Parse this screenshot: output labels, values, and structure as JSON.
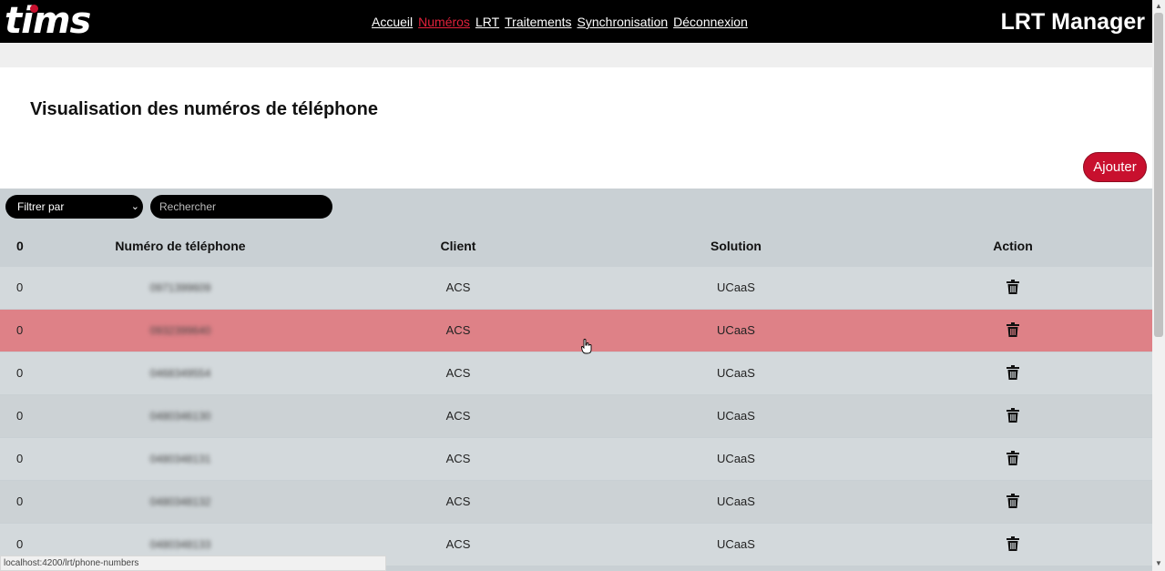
{
  "header": {
    "logo_text": "tims",
    "app_title": "LRT Manager",
    "nav": [
      {
        "label": "Accueil",
        "active": false
      },
      {
        "label": "Numéros",
        "active": true
      },
      {
        "label": "LRT",
        "active": false
      },
      {
        "label": "Traitements",
        "active": false
      },
      {
        "label": "Synchronisation",
        "active": false
      },
      {
        "label": "Déconnexion",
        "active": false
      }
    ]
  },
  "page": {
    "title": "Visualisation des numéros de téléphone",
    "add_button": "Ajouter"
  },
  "filters": {
    "filter_select": "Filtrer par",
    "search_placeholder": "Rechercher"
  },
  "table": {
    "headers": [
      "0",
      "Numéro de téléphone",
      "Client",
      "Solution",
      "Action"
    ],
    "rows": [
      {
        "c0": "0",
        "phone": "0971399609",
        "client": "ACS",
        "solution": "UCaaS",
        "highlighted": false
      },
      {
        "c0": "0",
        "phone": "0932399640",
        "client": "ACS",
        "solution": "UCaaS",
        "highlighted": true
      },
      {
        "c0": "0",
        "phone": "0468349554",
        "client": "ACS",
        "solution": "UCaaS",
        "highlighted": false
      },
      {
        "c0": "0",
        "phone": "0480346130",
        "client": "ACS",
        "solution": "UCaaS",
        "highlighted": false
      },
      {
        "c0": "0",
        "phone": "0480348131",
        "client": "ACS",
        "solution": "UCaaS",
        "highlighted": false
      },
      {
        "c0": "0",
        "phone": "0480348132",
        "client": "ACS",
        "solution": "UCaaS",
        "highlighted": false
      },
      {
        "c0": "0",
        "phone": "0480348133",
        "client": "ACS",
        "solution": "UCaaS",
        "highlighted": false
      }
    ]
  },
  "status_bar": "localhost:4200/lrt/phone-numbers",
  "colors": {
    "brand_red": "#c8102e",
    "highlight_row": "#de8187",
    "header_bg": "#000000"
  }
}
